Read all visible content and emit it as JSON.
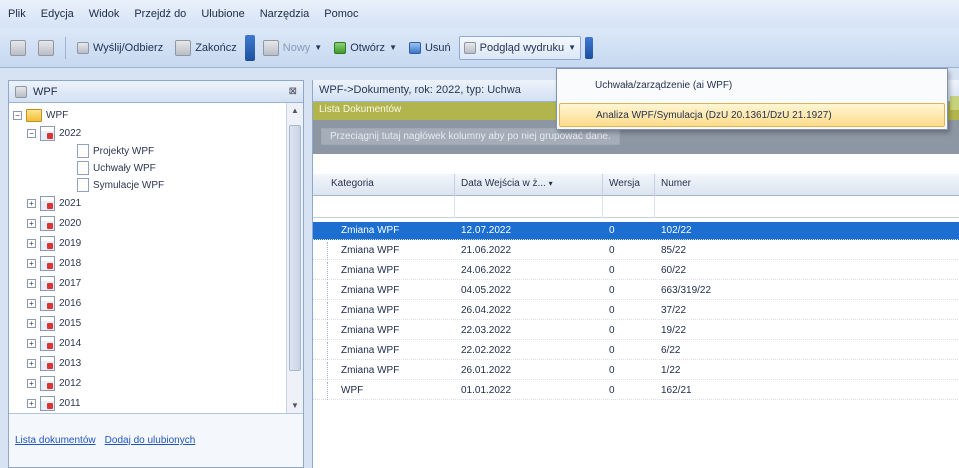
{
  "menu": [
    "Plik",
    "Edycja",
    "Widok",
    "Przejdź do",
    "Ulubione",
    "Narzędzia",
    "Pomoc"
  ],
  "toolbar": {
    "send_receive": "Wyślij/Odbierz",
    "finish": "Zakończ",
    "new": "Nowy",
    "open": "Otwórz",
    "delete": "Usuń",
    "print_preview": "Podgląd wydruku"
  },
  "dropdown": {
    "items": [
      "Uchwała/zarządzenie (ai WPF)",
      "Analiza WPF/Symulacja (DzU 20.1361/DzU 21.1927)"
    ]
  },
  "left_panel": {
    "title": "WPF",
    "tree": {
      "root": "WPF",
      "year_open": "2022",
      "children": [
        "Projekty WPF",
        "Uchwały WPF",
        "Symulacje WPF"
      ],
      "years": [
        "2021",
        "2020",
        "2019",
        "2018",
        "2017",
        "2016",
        "2015",
        "2014",
        "2013",
        "2012",
        "2011"
      ]
    },
    "footer_links": [
      "Lista dokumentów",
      "Dodaj do ulubionych"
    ]
  },
  "right_panel": {
    "path": "WPF->Dokumenty, rok: 2022, typ: Uchwa",
    "list_title": "Lista Dokumentów",
    "group_hint": "Przeciągnij tutaj nagłówek kolumny aby po niej grupować dane.",
    "columns": [
      "Kategoria",
      "Data Wejścia w ż...",
      "Wersja",
      "Numer"
    ],
    "rows": [
      {
        "kategoria": "Zmiana WPF",
        "data": "12.07.2022",
        "wersja": "0",
        "numer": "102/22"
      },
      {
        "kategoria": "Zmiana WPF",
        "data": "21.06.2022",
        "wersja": "0",
        "numer": "85/22"
      },
      {
        "kategoria": "Zmiana WPF",
        "data": "24.06.2022",
        "wersja": "0",
        "numer": "60/22"
      },
      {
        "kategoria": "Zmiana WPF",
        "data": "04.05.2022",
        "wersja": "0",
        "numer": "663/319/22"
      },
      {
        "kategoria": "Zmiana WPF",
        "data": "26.04.2022",
        "wersja": "0",
        "numer": "37/22"
      },
      {
        "kategoria": "Zmiana WPF",
        "data": "22.03.2022",
        "wersja": "0",
        "numer": "19/22"
      },
      {
        "kategoria": "Zmiana WPF",
        "data": "22.02.2022",
        "wersja": "0",
        "numer": "6/22"
      },
      {
        "kategoria": "Zmiana WPF",
        "data": "26.01.2022",
        "wersja": "0",
        "numer": "1/22"
      },
      {
        "kategoria": "WPF",
        "data": "01.01.2022",
        "wersja": "0",
        "numer": "162/21"
      }
    ]
  }
}
